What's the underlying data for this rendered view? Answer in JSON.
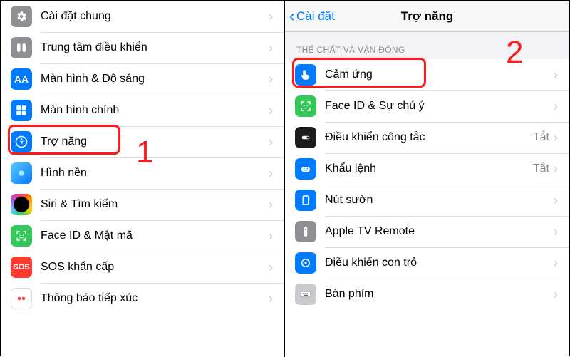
{
  "left": {
    "items": [
      {
        "label": "Cài đặt chung"
      },
      {
        "label": "Trung tâm điều khiển"
      },
      {
        "label": "Màn hình & Độ sáng"
      },
      {
        "label": "Màn hình chính"
      },
      {
        "label": "Trợ năng"
      },
      {
        "label": "Hình nền"
      },
      {
        "label": "Siri & Tìm kiếm"
      },
      {
        "label": "Face ID & Mật mã"
      },
      {
        "label": "SOS khẩn cấp"
      },
      {
        "label": "Thông báo tiếp xúc"
      }
    ],
    "highlight_index": 4,
    "annotation_number": "1"
  },
  "right": {
    "back_label": "Cài đặt",
    "title": "Trợ năng",
    "section_header": "THỂ CHẤT VÀ VẬN ĐỘNG",
    "items": [
      {
        "label": "Cảm ứng",
        "value": ""
      },
      {
        "label": "Face ID & Sự chú ý",
        "value": ""
      },
      {
        "label": "Điều khiển công tắc",
        "value": "Tắt"
      },
      {
        "label": "Khẩu lệnh",
        "value": "Tắt"
      },
      {
        "label": "Nút sườn",
        "value": ""
      },
      {
        "label": "Apple TV Remote",
        "value": ""
      },
      {
        "label": "Điều khiển con trỏ",
        "value": ""
      },
      {
        "label": "Bàn phím",
        "value": ""
      }
    ],
    "highlight_index": 0,
    "annotation_number": "2"
  }
}
